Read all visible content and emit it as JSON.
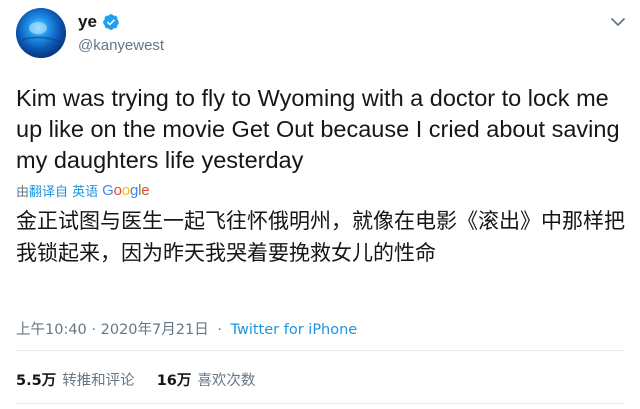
{
  "author": {
    "display_name": "ye",
    "handle": "@kanyewest",
    "verified_color": "#1da1f2"
  },
  "tweet": {
    "text": "Kim was trying to fly to Wyoming with a doctor to lock me up like on the movie Get Out because I cried about saving my daughters life yesterday",
    "translate_prefix": "由",
    "translate_link": "翻译自 英语",
    "translated_by": "Google",
    "translated_text": "金正试图与医生一起飞往怀俄明州，就像在电影《滚出》中那样把我锁起来，因为昨天我哭着要挽救女儿的性命",
    "timestamp": "上午10:40 · 2020年7月21日",
    "separator": "·",
    "source": "Twitter for iPhone"
  },
  "stats": {
    "retweets_count": "5.5万",
    "retweets_label": "转推和评论",
    "likes_count": "16万",
    "likes_label": "喜欢次数"
  },
  "icons": {
    "avatar": "avatar-image",
    "verified": "verified-badge-icon",
    "caret": "chevron-down-icon"
  }
}
